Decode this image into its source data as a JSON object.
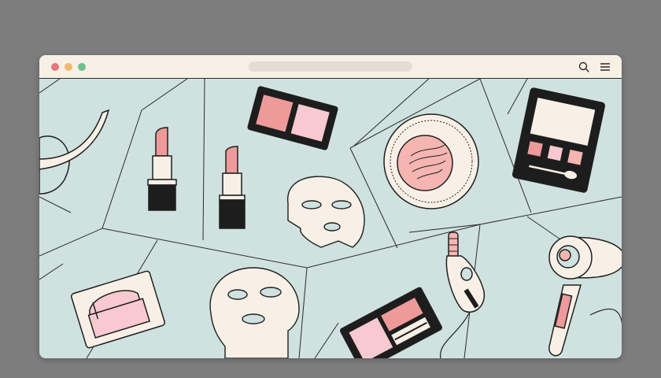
{
  "window": {
    "controls": [
      {
        "name": "close-dot",
        "color": "#e8757c"
      },
      {
        "name": "minimize-dot",
        "color": "#f2b86e"
      },
      {
        "name": "maximize-dot",
        "color": "#6cc18e"
      }
    ],
    "address_bar": {
      "text": ""
    },
    "toolbar_icons": [
      "search-icon",
      "menu-icon"
    ]
  },
  "colors": {
    "background": "#7d7d7d",
    "canvas": "#cfe2df",
    "titlebar": "#f8efe5",
    "outline": "#1f1f1f",
    "pink": "#ee9a9a",
    "light_pink": "#f8c9d0",
    "cream": "#f8f0e6"
  },
  "illustration": {
    "items": [
      "headband-icon",
      "lipstick-icon",
      "lipstick-icon",
      "blush-palette-icon",
      "face-mask-sheet-icon",
      "compact-powder-icon",
      "eyeshadow-palette-icon",
      "makeup-pad-icon",
      "face-mask-sheet-icon",
      "eyeshadow-palette-icon",
      "facial-massager-icon",
      "hair-dryer-icon"
    ]
  }
}
